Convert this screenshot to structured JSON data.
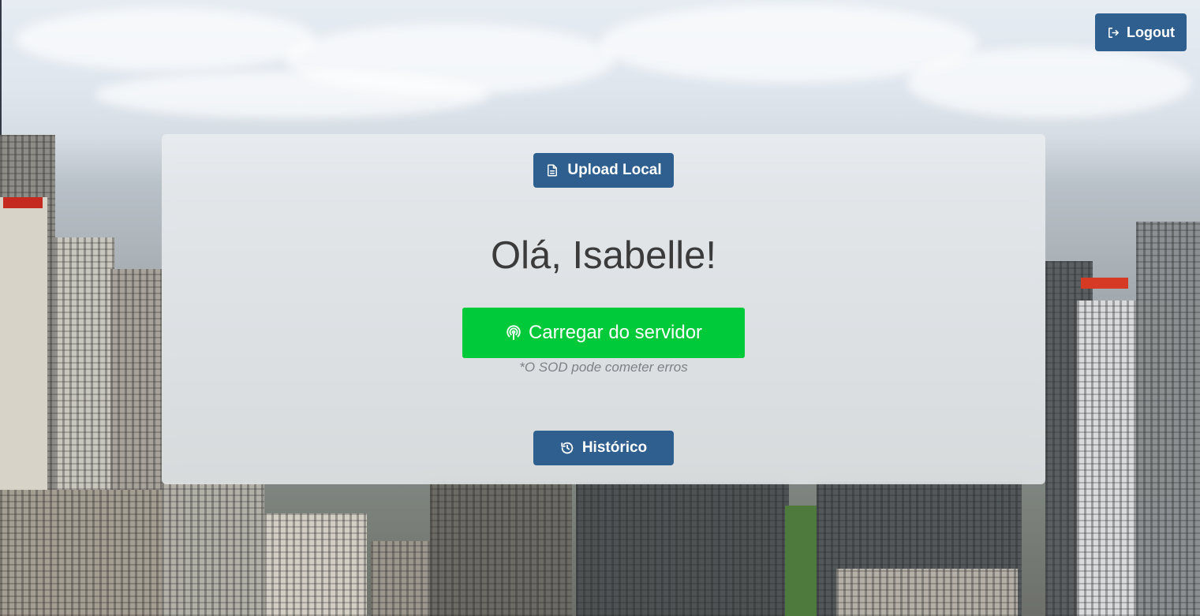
{
  "header": {
    "logout_label": "Logout",
    "logout_icon": "logout-icon"
  },
  "panel": {
    "upload_label": "Upload Local",
    "upload_icon": "file-icon",
    "greeting": "Olá, Isabelle!",
    "server_label": "Carregar do servidor",
    "server_icon": "broadcast-icon",
    "disclaimer": "*O SOD pode cometer erros",
    "history_label": "Histórico",
    "history_icon": "history-icon"
  },
  "colors": {
    "primary": "#2f5f8f",
    "success": "#00c93a",
    "greeting_text": "#3b3b3b",
    "muted_text": "#7d8286"
  }
}
